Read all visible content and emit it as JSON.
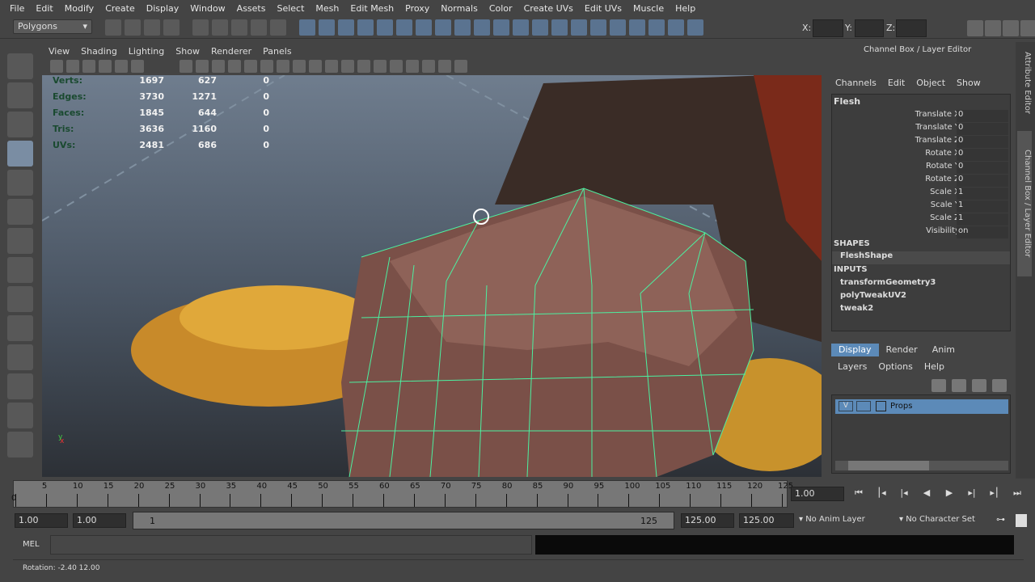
{
  "menu": [
    "File",
    "Edit",
    "Modify",
    "Create",
    "Display",
    "Window",
    "Assets",
    "Select",
    "Mesh",
    "Edit Mesh",
    "Proxy",
    "Normals",
    "Color",
    "Create UVs",
    "Edit UVs",
    "Muscle",
    "Help"
  ],
  "status": {
    "menu_set": "Polygons",
    "x_label": "X:",
    "y_label": "Y:",
    "z_label": "Z:"
  },
  "panel_menu": [
    "View",
    "Shading",
    "Lighting",
    "Show",
    "Renderer",
    "Panels"
  ],
  "hud": {
    "rows": [
      {
        "label": "Verts:",
        "a": "1697",
        "b": "627",
        "c": "0"
      },
      {
        "label": "Edges:",
        "a": "3730",
        "b": "1271",
        "c": "0"
      },
      {
        "label": "Faces:",
        "a": "1845",
        "b": "644",
        "c": "0"
      },
      {
        "label": "Tris:",
        "a": "3636",
        "b": "1160",
        "c": "0"
      },
      {
        "label": "UVs:",
        "a": "2481",
        "b": "686",
        "c": "0"
      }
    ]
  },
  "channel_box": {
    "title": "Channel Box / Layer Editor",
    "menus": [
      "Channels",
      "Edit",
      "Object",
      "Show"
    ],
    "object": "Flesh",
    "attrs": [
      {
        "n": "Translate X",
        "v": "0"
      },
      {
        "n": "Translate Y",
        "v": "0"
      },
      {
        "n": "Translate Z",
        "v": "0"
      },
      {
        "n": "Rotate X",
        "v": "0"
      },
      {
        "n": "Rotate Y",
        "v": "0"
      },
      {
        "n": "Rotate Z",
        "v": "0"
      },
      {
        "n": "Scale X",
        "v": "1"
      },
      {
        "n": "Scale Y",
        "v": "1"
      },
      {
        "n": "Scale Z",
        "v": "1"
      },
      {
        "n": "Visibility",
        "v": "on"
      }
    ],
    "shapes_label": "SHAPES",
    "shape": "FleshShape",
    "inputs_label": "INPUTS",
    "inputs": [
      "transformGeometry3",
      "polyTweakUV2",
      "tweak2"
    ]
  },
  "layer_editor": {
    "tabs": [
      "Display",
      "Render",
      "Anim"
    ],
    "menus": [
      "Layers",
      "Options",
      "Help"
    ],
    "layer": {
      "v": "V",
      "name": "Props"
    }
  },
  "side_tabs": [
    "Attribute Editor",
    "Channel Box / Layer Editor"
  ],
  "timeline": {
    "ticks": [
      0,
      5,
      10,
      15,
      20,
      25,
      30,
      35,
      40,
      45,
      50,
      55,
      60,
      65,
      70,
      75,
      80,
      85,
      90,
      95,
      100,
      105,
      110,
      115,
      120,
      125
    ],
    "current": "1.00"
  },
  "range": {
    "start": "1.00",
    "start2": "1.00",
    "slider_start": "1",
    "slider_end": "125",
    "end": "125.00",
    "end2": "125.00",
    "anim_layer": "No Anim Layer",
    "char_set": "No Character Set"
  },
  "cmd": {
    "label": "MEL"
  },
  "help_line": "Rotation:  -2.40    12.00",
  "accent": "#5c8ab8",
  "wire": "#4cf0a0"
}
